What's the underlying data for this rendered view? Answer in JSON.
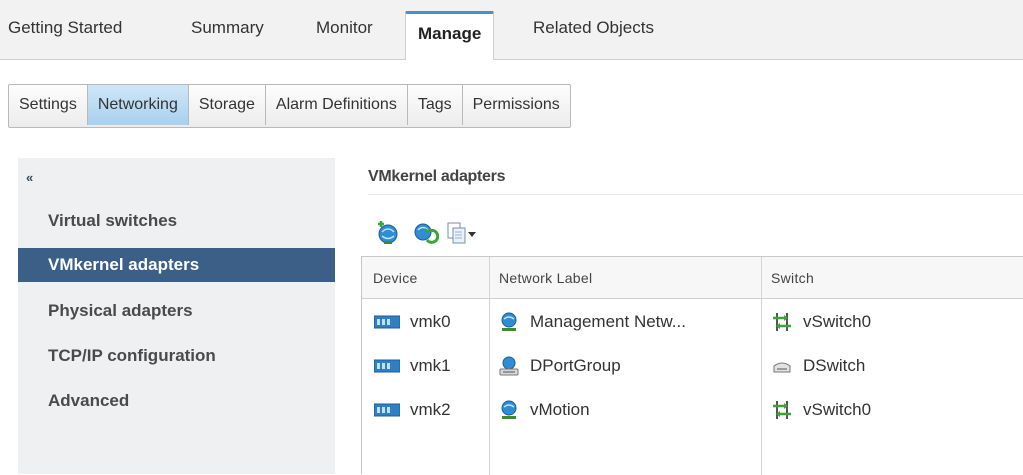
{
  "top_tabs": [
    "Getting Started",
    "Summary",
    "Monitor",
    "Manage",
    "Related Objects"
  ],
  "top_tabs_active": "Manage",
  "sub_tabs": [
    "Settings",
    "Networking",
    "Storage",
    "Alarm Definitions",
    "Tags",
    "Permissions"
  ],
  "sub_tabs_active": "Networking",
  "left_nav": {
    "collapse_glyph": "«",
    "items": [
      "Virtual switches",
      "VMkernel adapters",
      "Physical adapters",
      "TCP/IP configuration",
      "Advanced"
    ],
    "active": "VMkernel adapters"
  },
  "panel": {
    "title": "VMkernel adapters",
    "toolbar_icons": [
      "add-host-networking-icon",
      "refresh-network-icon",
      "actions-dropdown-icon"
    ]
  },
  "table": {
    "columns": [
      "Device",
      "Network Label",
      "Switch"
    ],
    "rows": [
      {
        "device": "vmk0",
        "network_label": "Management Netw...",
        "network_icon": "standard-portgroup-icon",
        "switch": "vSwitch0",
        "switch_icon": "standard-switch-icon"
      },
      {
        "device": "vmk1",
        "network_label": "DPortGroup",
        "network_icon": "distributed-portgroup-icon",
        "switch": "DSwitch",
        "switch_icon": "distributed-switch-icon"
      },
      {
        "device": "vmk2",
        "network_label": "vMotion",
        "network_icon": "standard-portgroup-icon",
        "switch": "vSwitch0",
        "switch_icon": "standard-switch-icon"
      }
    ]
  },
  "colors": {
    "active_nav_bg": "#3b5f86",
    "active_subtab_bg": "#a9d0ef",
    "active_tab_accent": "#4a90c9"
  }
}
